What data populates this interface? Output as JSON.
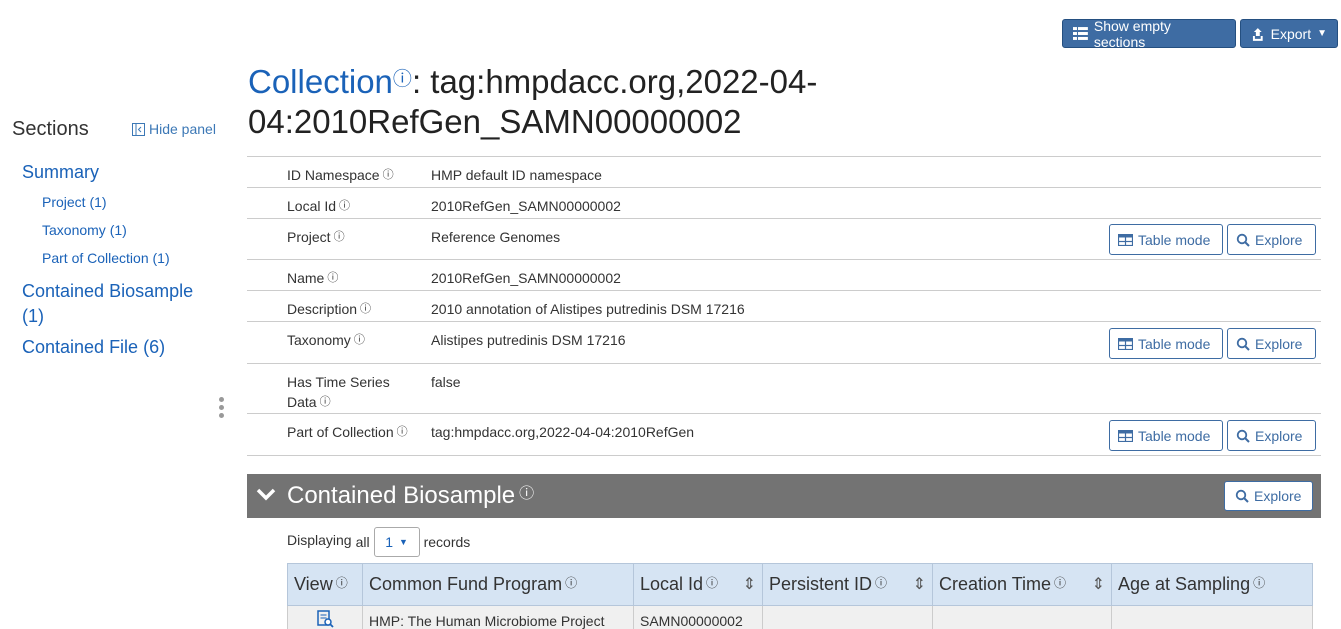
{
  "toolbar": {
    "show_empty_label": "Show empty sections",
    "export_label": "Export"
  },
  "sidebar": {
    "title": "Sections",
    "hide_panel_label": "Hide panel",
    "items": [
      {
        "label": "Summary"
      },
      {
        "label": "Project (1)"
      },
      {
        "label": "Taxonomy (1)"
      },
      {
        "label": "Part of Collection (1)"
      },
      {
        "label": "Contained Biosample (1)"
      },
      {
        "label": "Contained File (6)"
      }
    ]
  },
  "page": {
    "type_label": "Collection",
    "info_symbol": "ⓘ",
    "title_rest": ": tag:hmpdacc.org,2022-04-04:2010RefGen_SAMN00000002"
  },
  "summary": {
    "rows": [
      {
        "label": "ID Namespace",
        "value": "HMP default ID namespace"
      },
      {
        "label": "Local Id",
        "value": "2010RefGen_SAMN00000002"
      },
      {
        "label": "Project",
        "value": "Reference Genomes"
      },
      {
        "label": "Name",
        "value": "2010RefGen_SAMN00000002"
      },
      {
        "label": "Description",
        "value": "2010 annotation of Alistipes putredinis DSM 17216"
      },
      {
        "label": "Taxonomy",
        "value": "Alistipes putredinis DSM 17216"
      },
      {
        "label_line1": "Has Time Series",
        "label_line2": "Data",
        "value": "false"
      },
      {
        "label": "Part of Collection",
        "value": "tag:hmpdacc.org,2022-04-04:2010RefGen"
      }
    ],
    "table_mode_label": "Table mode",
    "explore_label": "Explore"
  },
  "biosample": {
    "title": "Contained Biosample",
    "explore_label": "Explore",
    "displaying_label": "Displaying",
    "all_label": "all",
    "page_size": "1",
    "records_label": "records",
    "columns": [
      "View",
      "Common Fund Program",
      "Local Id",
      "Persistent ID",
      "Creation Time",
      "Age at Sampling"
    ],
    "rows": [
      {
        "program": "HMP: The Human Microbiome Project",
        "local_id": "SAMN00000002",
        "persistent_id": "",
        "creation_time": "",
        "age": ""
      }
    ]
  },
  "colors": {
    "link": "#1a62b8",
    "button_primary": "#3e6ca3",
    "section_bar": "#737373",
    "table_header": "#d6e4f3"
  }
}
